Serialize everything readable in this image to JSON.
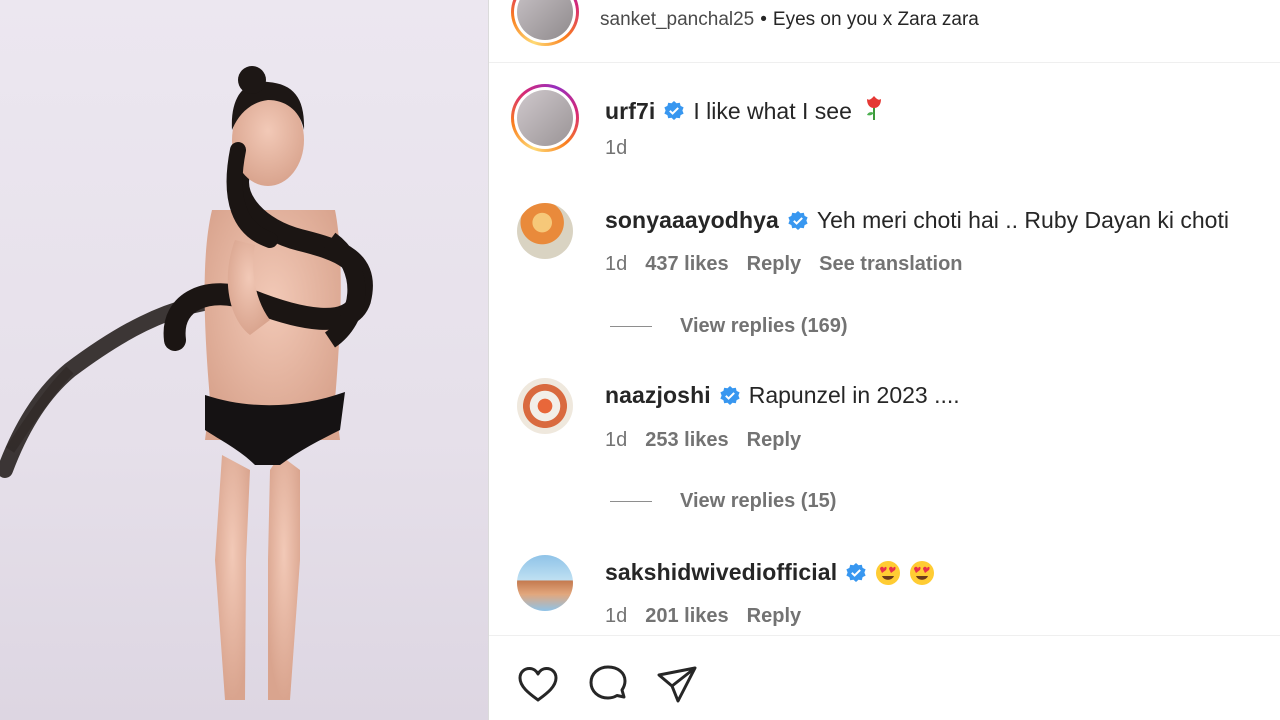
{
  "post": {
    "author": "sanket_panchal25",
    "separator": "•",
    "audio": "Eyes on you x Zara zara"
  },
  "caption": {
    "username": "urf7i",
    "text": "I like what I see",
    "emoji": "rose",
    "time": "1d"
  },
  "comments": [
    {
      "username": "sonyaaayodhya",
      "text": "Yeh meri choti hai .. Ruby Dayan ki choti",
      "time": "1d",
      "likes": "437 likes",
      "reply": "Reply",
      "translate": "See translation",
      "view_replies": "View replies (169)"
    },
    {
      "username": "naazjoshi",
      "text": "Rapunzel in 2023 ....",
      "time": "1d",
      "likes": "253 likes",
      "reply": "Reply",
      "view_replies": "View replies (15)"
    },
    {
      "username": "sakshidwivediofficial",
      "emojis": [
        "heart-eyes",
        "heart-eyes"
      ],
      "time": "1d",
      "likes": "201 likes",
      "reply": "Reply"
    }
  ],
  "icons": {
    "like": "heart-icon",
    "comment": "comment-icon",
    "share": "share-icon",
    "verified": "verified-badge-icon"
  },
  "colors": {
    "verified": "#3897f0",
    "text_primary": "#262626",
    "text_secondary": "#737373"
  }
}
